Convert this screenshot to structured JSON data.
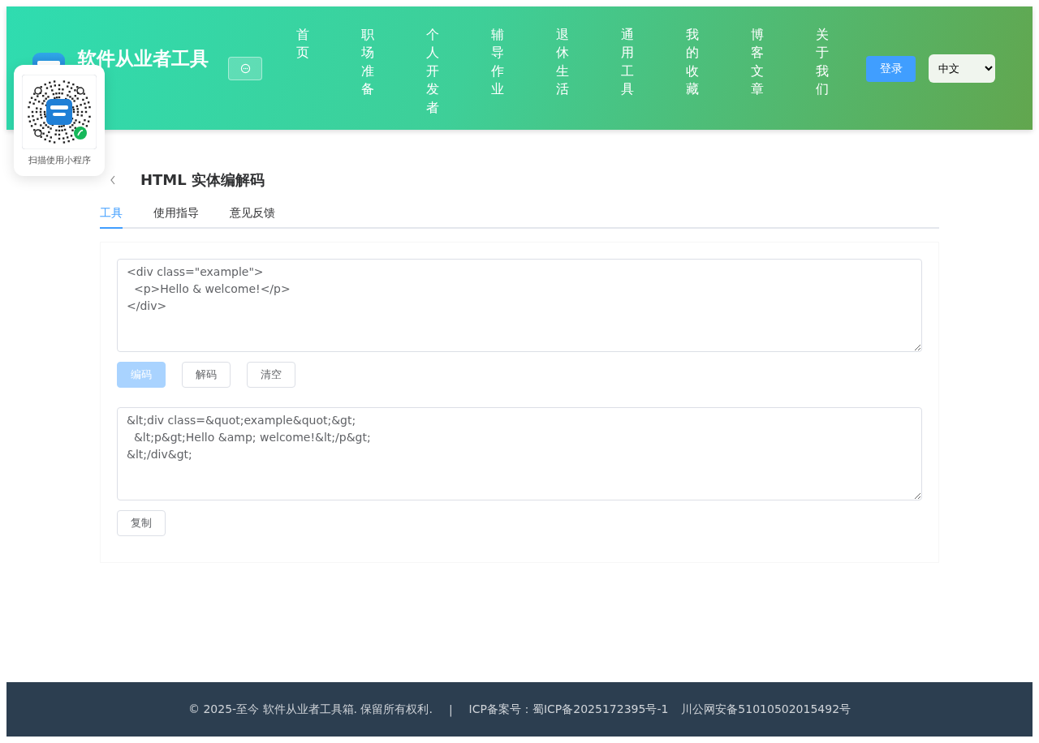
{
  "header": {
    "site_title": "软件从业者工具",
    "nav": [
      {
        "label": "首页"
      },
      {
        "label": "职场准备"
      },
      {
        "label": "个人开发者"
      },
      {
        "label": "辅导作业"
      },
      {
        "label": "退休生活"
      },
      {
        "label": "通用工具"
      },
      {
        "label": "我的收藏"
      },
      {
        "label": "博客文章"
      },
      {
        "label": "关于我们"
      }
    ],
    "login_button": "登录",
    "language": "中文"
  },
  "qr_popup": {
    "caption": "扫描使用小程序"
  },
  "page": {
    "title": "HTML 实体编解码",
    "tabs": [
      {
        "label": "工具",
        "selected": true
      },
      {
        "label": "使用指导",
        "selected": false
      },
      {
        "label": "意见反馈",
        "selected": false
      }
    ],
    "input": {
      "value": "<div class=\"example\">\n  <p>Hello & welcome!</p>\n</div>"
    },
    "buttons": [
      {
        "label": "编码",
        "kind": "primary",
        "disabled": true
      },
      {
        "label": "解码",
        "kind": "plain",
        "disabled": false
      },
      {
        "label": "清空",
        "kind": "plain",
        "disabled": false
      }
    ],
    "output": {
      "value": "&lt;div class=&quot;example&quot;&gt;\n  &lt;p&gt;Hello &amp; welcome!&lt;/p&gt;\n&lt;/div&gt;"
    },
    "copy_button": "复制"
  },
  "footer": {
    "copyright": "© 2025-至今 软件从业者工具箱. 保留所有权利.",
    "separator": "|",
    "icp": "ICP备案号：蜀ICP备2025172395号-1",
    "police": "川公网安备51010502015492号"
  }
}
